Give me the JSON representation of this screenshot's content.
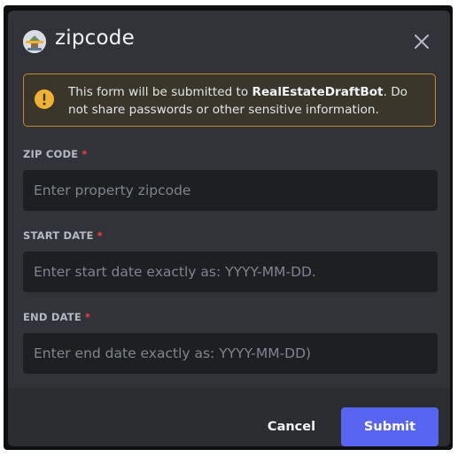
{
  "modal": {
    "title": "zipcode",
    "app_icon": "bot-avatar-icon",
    "close_icon": "close-icon"
  },
  "notice": {
    "icon": "warning-icon",
    "prefix": "This form will be submitted to ",
    "bot_name": "RealEstateDraftBot",
    "suffix": ". Do not share passwords or other sensitive information."
  },
  "fields": [
    {
      "label": "ZIP CODE",
      "required_mark": "*",
      "value": "",
      "placeholder": "Enter property zipcode"
    },
    {
      "label": "START DATE",
      "required_mark": "*",
      "value": "",
      "placeholder": "Enter start date exactly as: YYYY-MM-DD."
    },
    {
      "label": "END DATE",
      "required_mark": "*",
      "value": "",
      "placeholder": "Enter end date exactly as: YYYY-MM-DD)"
    }
  ],
  "footer": {
    "cancel_label": "Cancel",
    "submit_label": "Submit"
  },
  "colors": {
    "accent": "#5865f2",
    "warning": "#f0b232",
    "required": "#f23f43",
    "modal_bg": "#313338",
    "input_bg": "#1e1f22"
  }
}
